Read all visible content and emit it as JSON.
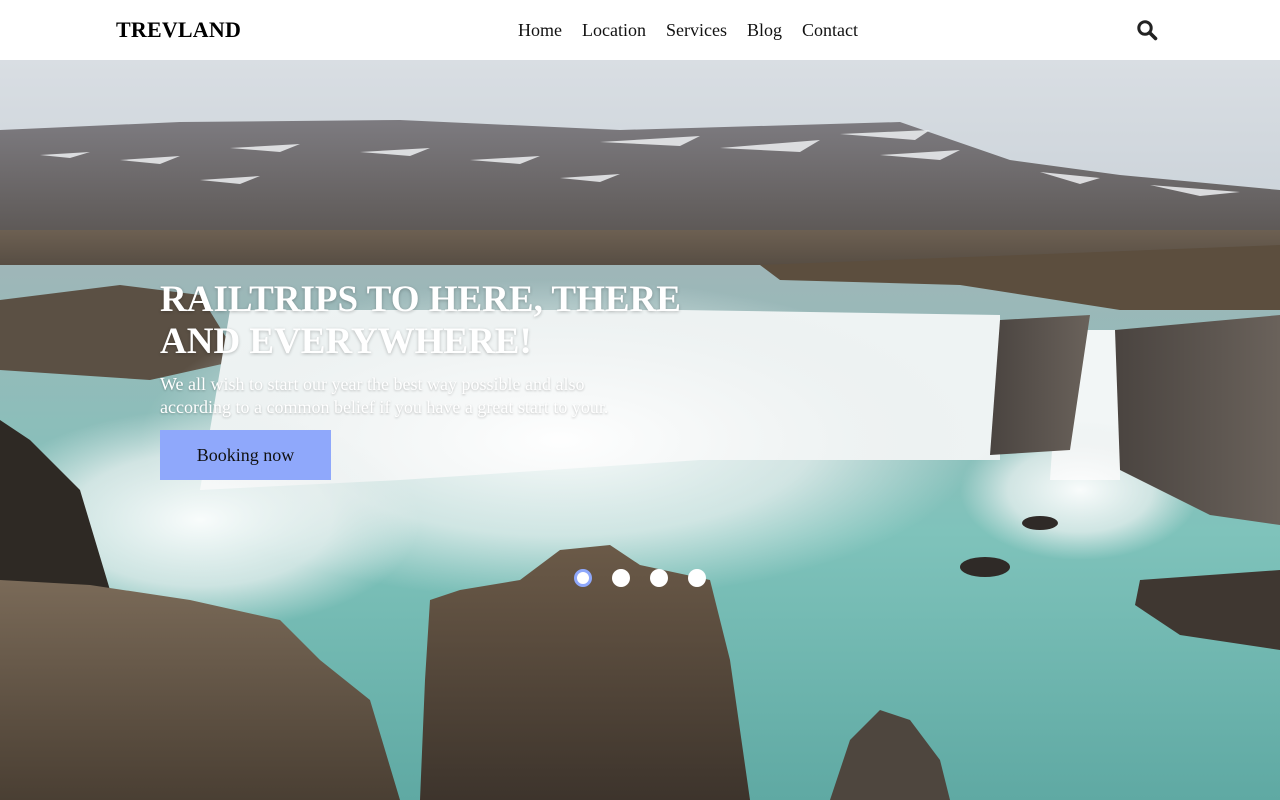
{
  "header": {
    "logo": "TREVLAND",
    "nav": [
      {
        "label": "Home"
      },
      {
        "label": "Location"
      },
      {
        "label": "Services"
      },
      {
        "label": "Blog"
      },
      {
        "label": "Contact"
      }
    ],
    "search_icon": "search-icon"
  },
  "hero": {
    "title_line1": "RAILTRIPS TO HERE, THERE",
    "title_line2": "AND EVERYWHERE!",
    "subtitle_line1": "We all wish to start our year the best way possible and also",
    "subtitle_line2": "according to a common belief if you have a great start to your.",
    "button_label": "Booking now",
    "slide_count": 4,
    "active_slide": 1
  },
  "colors": {
    "accent": "#8fa8fb",
    "header_bg": "#ffffff",
    "text_dark": "#111111",
    "hero_text": "#ffffff"
  }
}
